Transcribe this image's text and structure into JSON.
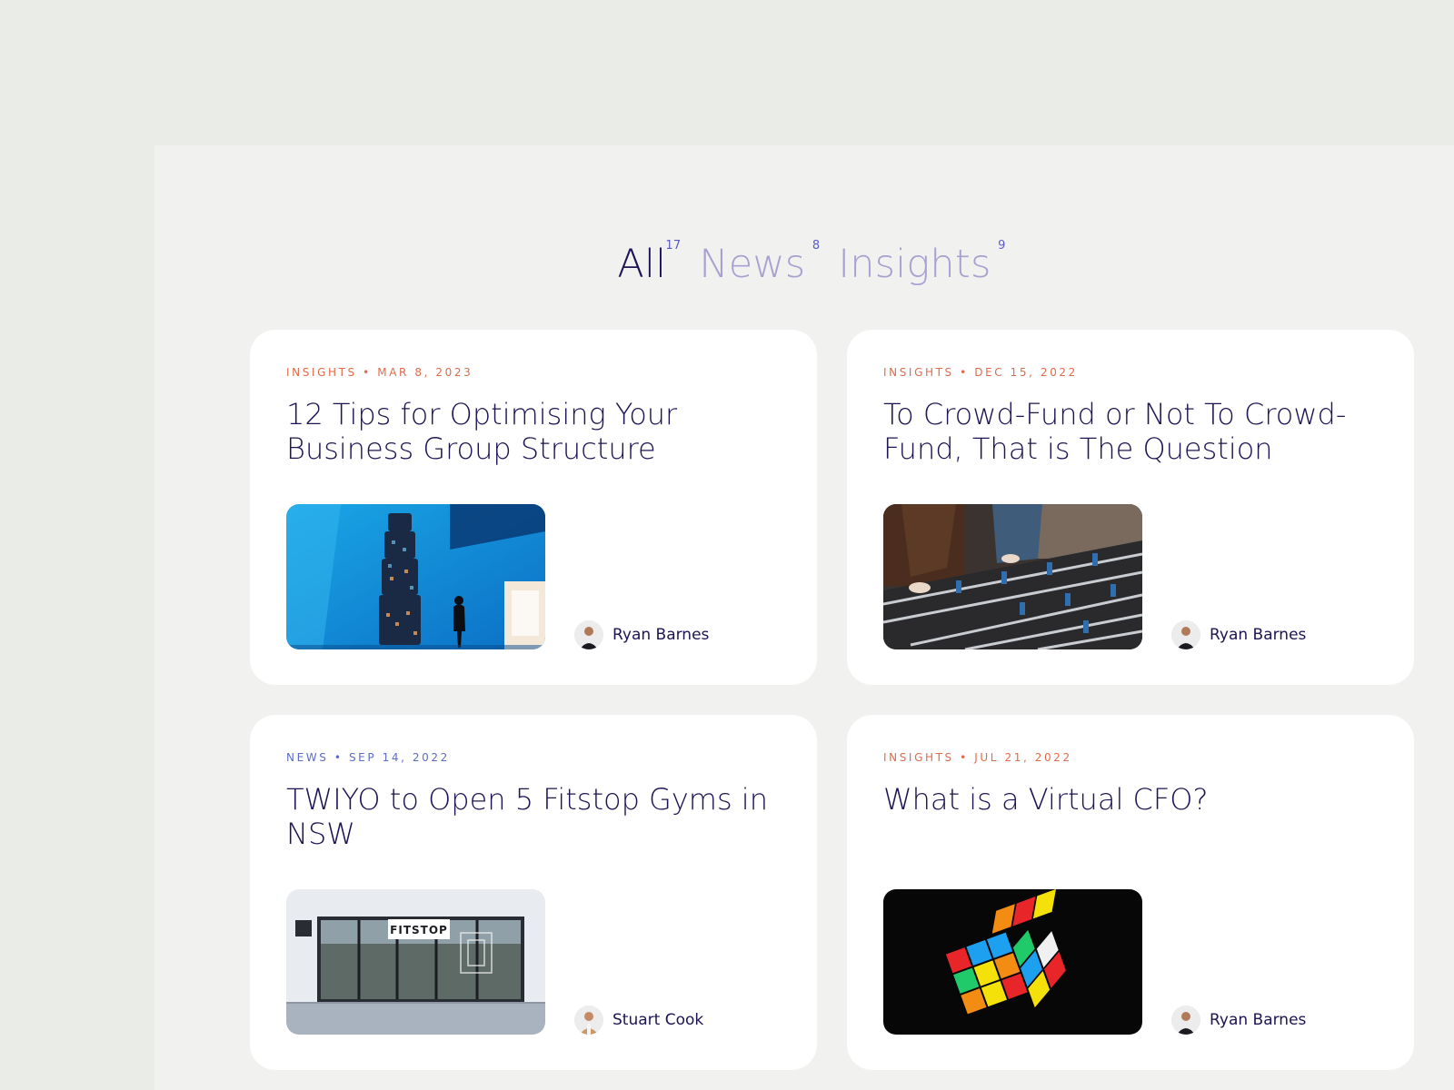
{
  "filters": [
    {
      "label": "All",
      "count": "17"
    },
    {
      "label": "News",
      "count": "8"
    },
    {
      "label": "Insights",
      "count": "9"
    }
  ],
  "posts": [
    {
      "category": "INSIGHTS",
      "date": "MAR 8, 2023",
      "meta": "INSIGHTS • MAR 8, 2023",
      "title": "12 Tips for Optimising Your Business Group Structure",
      "author": "Ryan Barnes",
      "image": "tower-installation-blue"
    },
    {
      "category": "INSIGHTS",
      "date": "DEC 15, 2022",
      "meta": "INSIGHTS • DEC 15, 2022",
      "title": "To Crowd-Fund or Not To Crowd-Fund, That is The Question",
      "author": "Ryan Barnes",
      "image": "foosball-table"
    },
    {
      "category": "NEWS",
      "date": "SEP 14, 2022",
      "meta": "NEWS • SEP 14, 2022",
      "title": "TWIYO to Open 5 Fitstop Gyms in NSW",
      "author": "Stuart Cook",
      "image": "fitstop-gym-storefront",
      "sign_text": "FITSTOP"
    },
    {
      "category": "INSIGHTS",
      "date": "JUL 21, 2022",
      "meta": "INSIGHTS • JUL 21, 2022",
      "title": "What is a Virtual CFO?",
      "author": "Ryan Barnes",
      "image": "rubiks-cube"
    }
  ],
  "colors": {
    "background": "#e9ece7",
    "panel": "#f1f1f0",
    "navy": "#1c1453",
    "filter_inactive": "#a9a0d0",
    "insights_accent": "#e06b4a",
    "news_accent": "#5b6bc7"
  }
}
